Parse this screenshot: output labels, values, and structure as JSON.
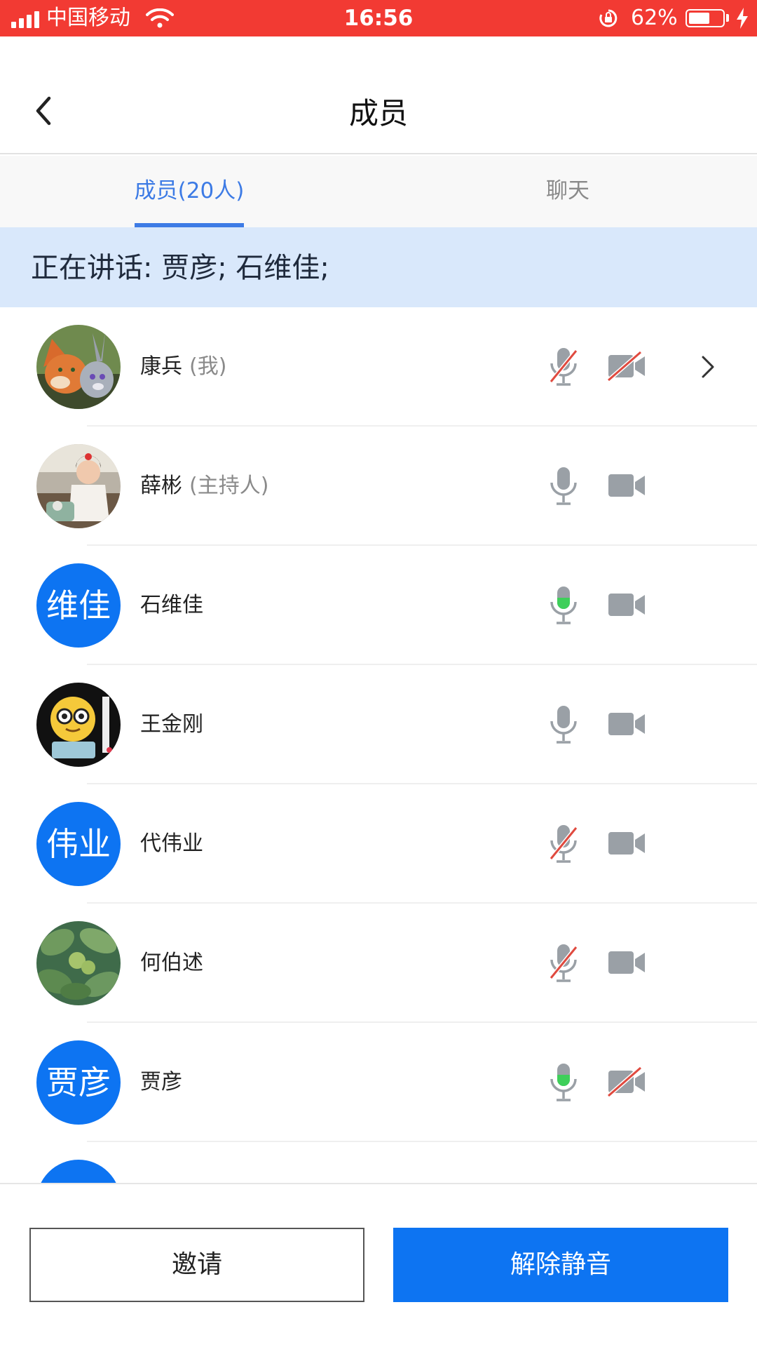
{
  "status_bar": {
    "carrier": "中国移动",
    "time": "16:56",
    "battery_percent": "62%",
    "battery_level": 0.62,
    "background_color": "#f23a33"
  },
  "nav": {
    "back_icon": "chevron-left-icon",
    "title": "成员"
  },
  "tabs": {
    "members_label": "成员(20人)",
    "chat_label": "聊天",
    "active_color": "#3d7be5"
  },
  "speaking": {
    "text": "正在讲话: 贾彦; 石维佳;"
  },
  "members": [
    {
      "name": "康兵",
      "role": "(我)",
      "avatar": "photo-cartoon-fox-rabbit",
      "mic": "muted",
      "camera": "off",
      "has_arrow": true
    },
    {
      "name": "薛彬",
      "role": "(主持人)",
      "avatar": "photo-child",
      "mic": "on",
      "camera": "on"
    },
    {
      "name": "石维佳",
      "role": "",
      "avatar_text": "维佳",
      "mic": "speaking",
      "camera": "on"
    },
    {
      "name": "王金刚",
      "role": "",
      "avatar": "photo-emoji-glasses",
      "mic": "on",
      "camera": "on"
    },
    {
      "name": "代伟业",
      "role": "",
      "avatar_text": "伟业",
      "mic": "muted",
      "camera": "on"
    },
    {
      "name": "何伯述",
      "role": "",
      "avatar": "photo-leaves",
      "mic": "muted",
      "camera": "on"
    },
    {
      "name": "贾彦",
      "role": "",
      "avatar_text": "贾彦",
      "mic": "speaking",
      "camera": "off"
    }
  ],
  "buttons": {
    "invite": "邀请",
    "unmute": "解除静音",
    "primary_color": "#0d74f2"
  },
  "icon_colors": {
    "gray": "#9aa0a6",
    "speaking_green": "#3ecf5a",
    "muted_slash": "#e04a3f"
  }
}
